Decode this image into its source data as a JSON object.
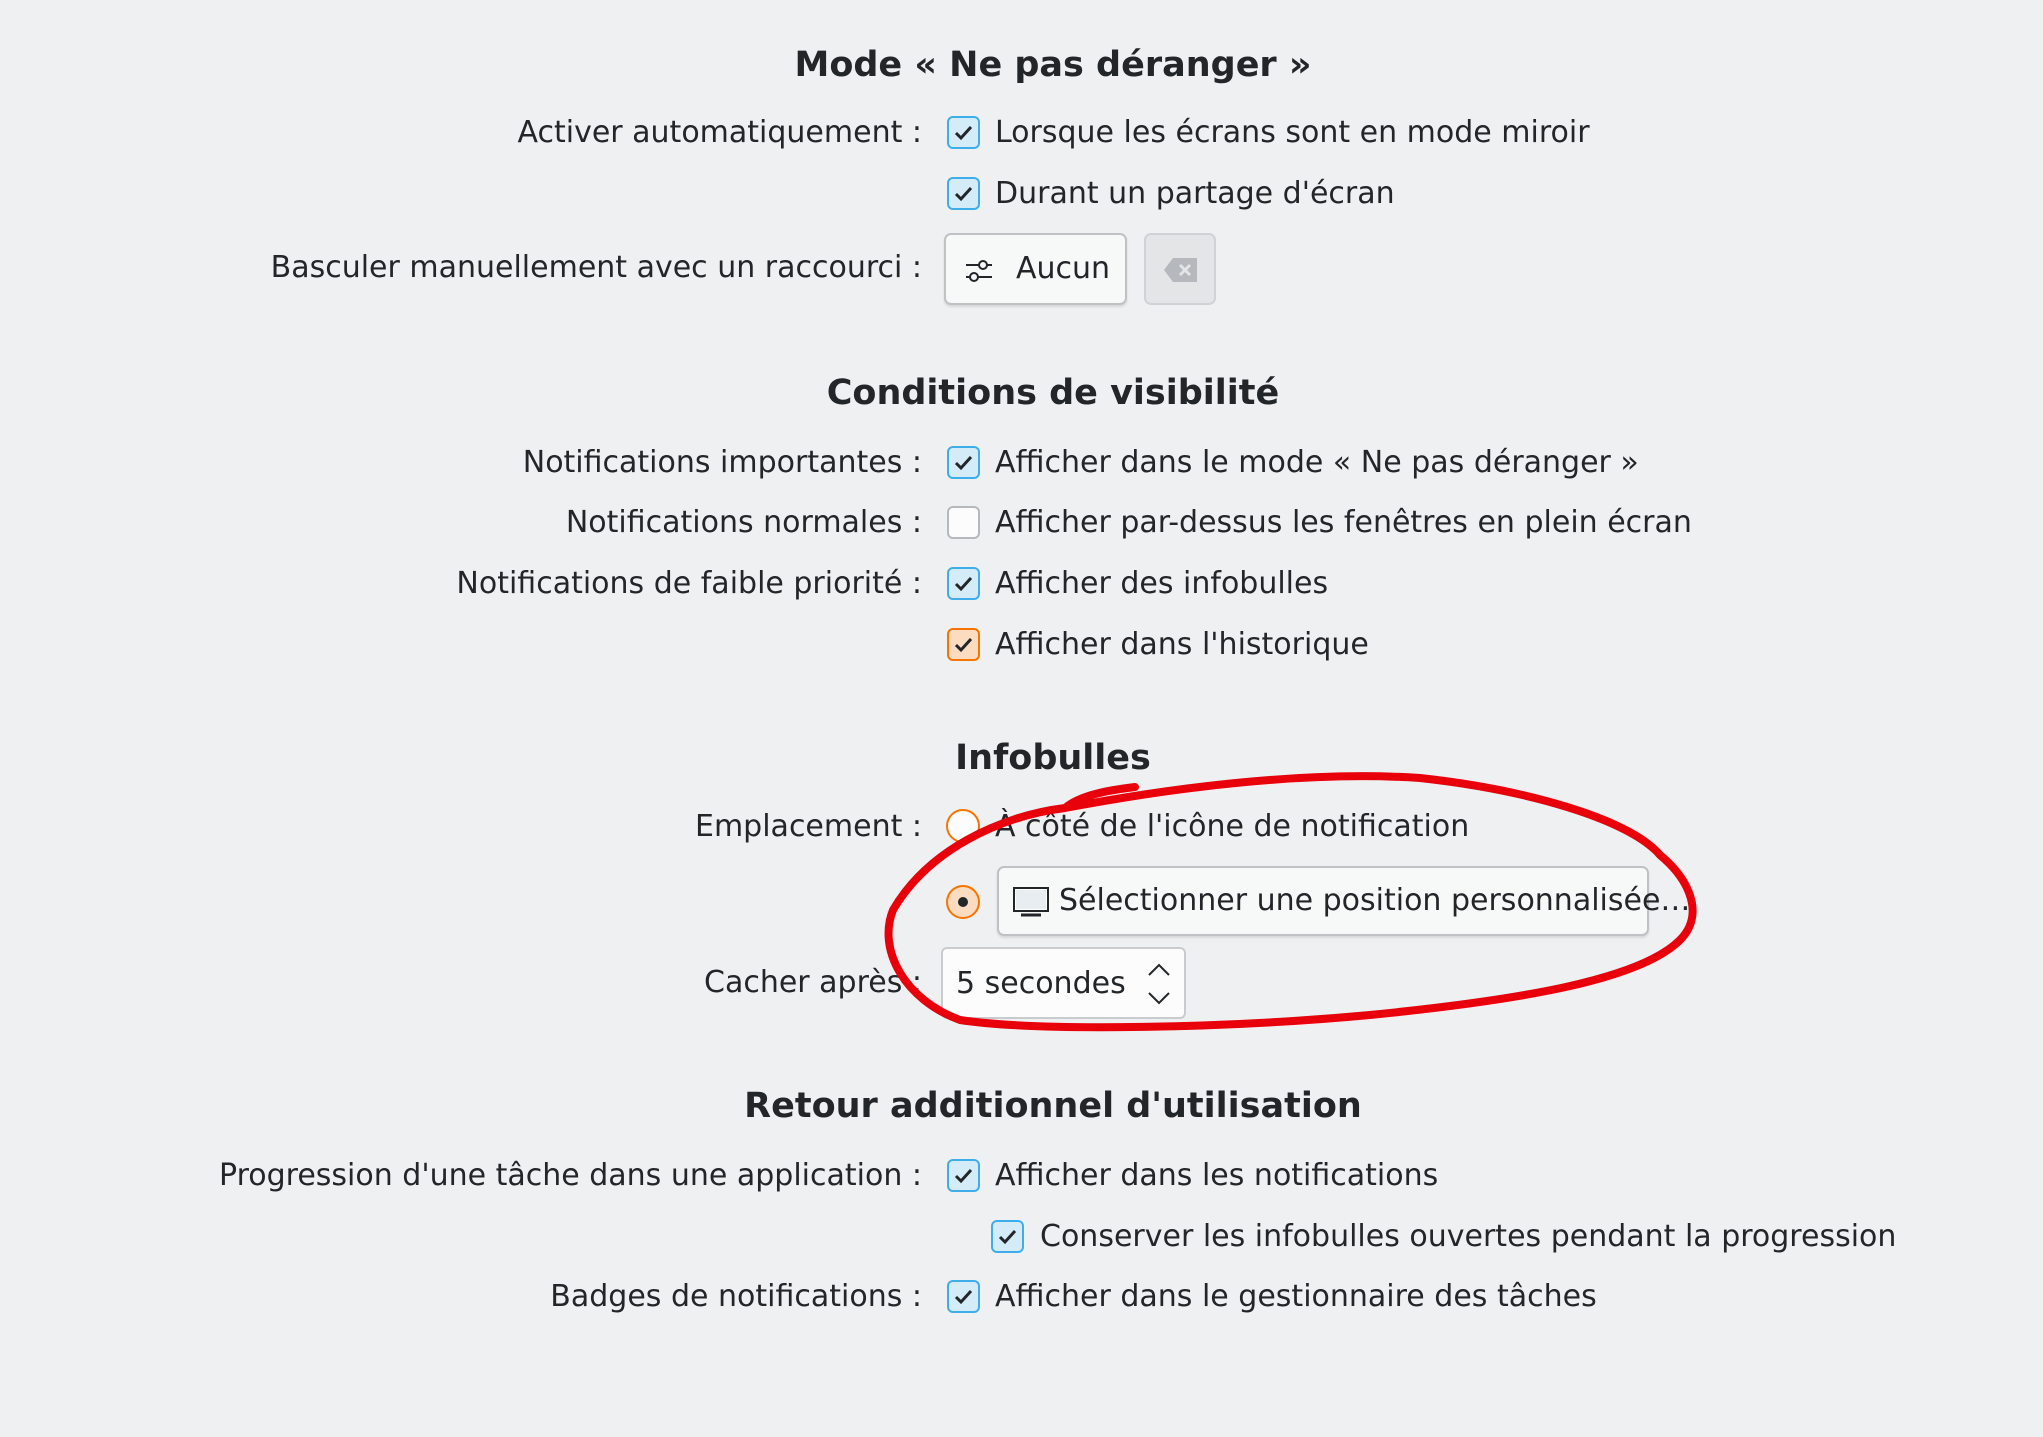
{
  "dnd": {
    "title": "Mode « Ne pas déranger »",
    "auto_label": "Activer automatiquement :",
    "mirror_option": "Lorsque les écrans sont en mode miroir",
    "screenshare_option": "Durant un partage d'écran",
    "shortcut_label": "Basculer manuellement avec un raccourci :",
    "shortcut_button": "Aucun"
  },
  "visibility": {
    "title": "Conditions de visibilité",
    "important_label": "Notifications importantes :",
    "important_option": "Afficher dans le mode « Ne pas déranger »",
    "normal_label": "Notifications normales :",
    "normal_option": "Afficher par-dessus les fenêtres en plein écran",
    "low_label": "Notifications de faible priorité :",
    "low_popups_option": "Afficher des infobulles",
    "low_history_option": "Afficher dans l'historique"
  },
  "popups": {
    "title": "Infobulles",
    "location_label": "Emplacement :",
    "near_icon_option": "À côté de l'icône de notification",
    "custom_position_button": "Sélectionner une position personnalisée…",
    "hide_after_label": "Cacher après :",
    "hide_after_value": "5 secondes"
  },
  "feedback": {
    "title": "Retour additionnel d'utilisation",
    "progress_label": "Progression d'une tâche dans une application :",
    "progress_option": "Afficher dans les notifications",
    "keep_popups_option": "Conserver les infobulles ouvertes pendant la progression",
    "badges_label": "Badges de notifications :",
    "badges_option": "Afficher dans le gestionnaire des tâches"
  },
  "annotation_color": "#e8000b"
}
